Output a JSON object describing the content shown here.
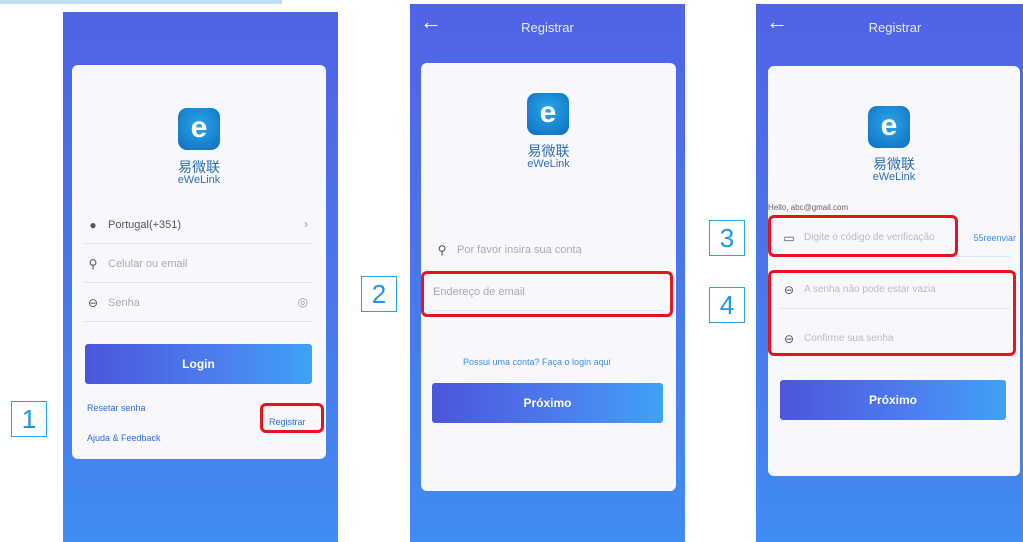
{
  "steps": [
    "1",
    "2",
    "3",
    "4"
  ],
  "brand": {
    "name_cn": "易微联",
    "name_en": "eWeLink",
    "logo_letter": "e"
  },
  "screen1": {
    "country_value": "Portugal(+351)",
    "account_placeholder": "Celular ou email",
    "password_placeholder": "Senha",
    "login_label": "Login",
    "reset_label": "Resetar senha",
    "register_label": "Registrar",
    "help_label": "Ajuda & Feedback"
  },
  "screen2": {
    "title": "Registrar",
    "account_label": "Por favor insira sua conta",
    "email_placeholder": "Endereço de email",
    "login_link": "Possui uma conta? Faça o login aqui",
    "next_label": "Próximo"
  },
  "screen3": {
    "title": "Registrar",
    "greeting": "Hello, abc@gmail.com",
    "code_placeholder": "Digite o código de verificação",
    "resend_label": "55reenviar",
    "password_placeholder": "A senha não pode estar vazia",
    "confirm_placeholder": "Confirme sua senha",
    "next_label": "Próximo"
  },
  "colors": {
    "accent": "#4c7fee",
    "highlight": "#e8131c",
    "step_label": "#1b98e3"
  }
}
